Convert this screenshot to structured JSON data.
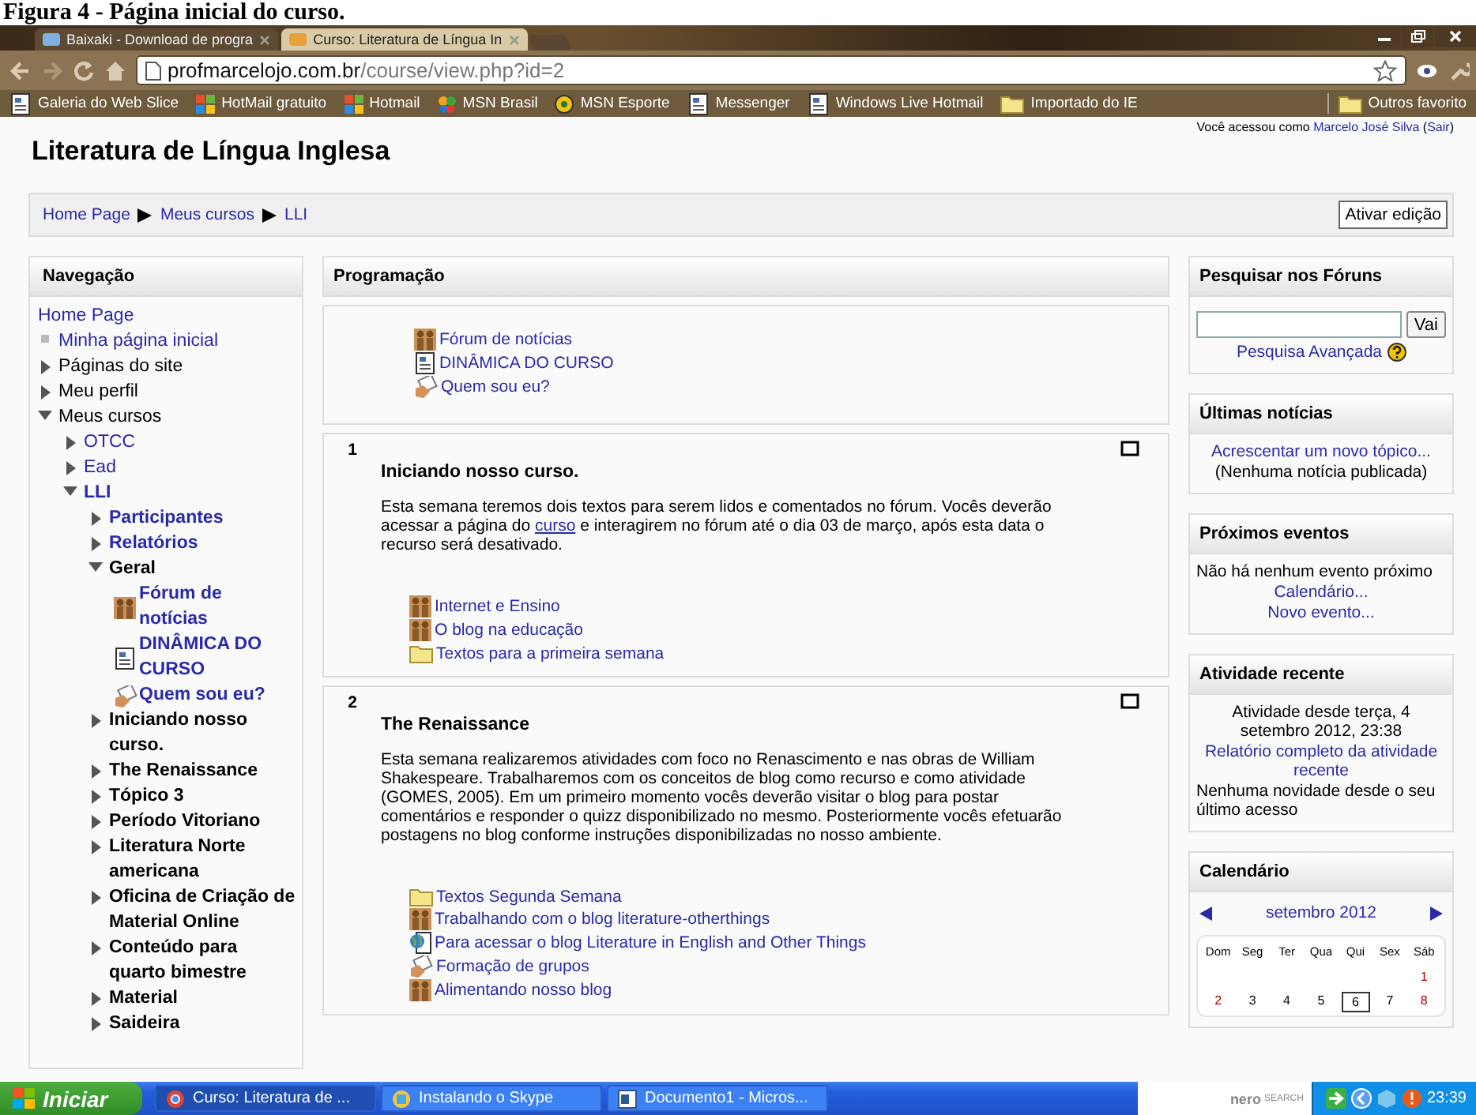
{
  "caption": "Figura 4 - Página inicial do curso.",
  "browser": {
    "tabs": [
      {
        "label": "Baixaki - Download de progra",
        "selected": false
      },
      {
        "label": "Curso: Literatura de Língua In",
        "selected": true
      }
    ],
    "url_host": "profmarcelojo.com.br",
    "url_path": "/course/view.php?id=2",
    "bookmarks": [
      "Galeria do Web Slice",
      "HotMail gratuito",
      "Hotmail",
      "MSN Brasil",
      "MSN Esporte",
      "Messenger",
      "Windows Live Hotmail",
      "Importado do IE"
    ],
    "other_bookmarks": "Outros favorito"
  },
  "header": {
    "title": "Literatura de Língua Inglesa",
    "login": [
      {
        "text": "Você acessou como "
      },
      {
        "text": "Marcelo José Silva",
        "link": true
      },
      {
        "text": " ("
      },
      {
        "text": "Sair",
        "link": true
      },
      {
        "text": ")"
      }
    ],
    "breadcrumb": [
      "Home Page",
      "Meus cursos",
      "LLI"
    ],
    "edit_button": "Ativar edição"
  },
  "nav": {
    "title": "Navegação",
    "items": [
      {
        "label": "Home Page",
        "kind": "root",
        "link": true
      },
      {
        "label": "Minha página inicial",
        "kind": "leaf",
        "link": true
      },
      {
        "label": "Páginas do site",
        "kind": "branch",
        "link": false,
        "expanded": false
      },
      {
        "label": "Meu perfil",
        "kind": "branch",
        "link": false,
        "expanded": false
      },
      {
        "label": "Meus cursos",
        "kind": "branch",
        "link": false,
        "expanded": true,
        "children": [
          {
            "label": "OTCC",
            "kind": "branch",
            "link": true,
            "expanded": false
          },
          {
            "label": "Ead",
            "kind": "branch",
            "link": true,
            "expanded": false
          },
          {
            "label": "LLI",
            "kind": "branch",
            "link": true,
            "expanded": true,
            "current": true,
            "children": [
              {
                "label": "Participantes",
                "kind": "branch",
                "link": true,
                "expanded": false
              },
              {
                "label": "Relatórios",
                "kind": "branch",
                "link": true,
                "expanded": false
              },
              {
                "label": "Geral",
                "kind": "branch",
                "link": false,
                "expanded": true,
                "children": [
                  {
                    "label": "Fórum de notícias",
                    "kind": "forum",
                    "link": true
                  },
                  {
                    "label": "DINÂMICA DO CURSO",
                    "kind": "page",
                    "link": true
                  },
                  {
                    "label": "Quem sou eu?",
                    "kind": "choice",
                    "link": true
                  }
                ]
              },
              {
                "label": "Iniciando nosso curso.",
                "kind": "branch",
                "link": false,
                "expanded": false
              },
              {
                "label": "The Renaissance",
                "kind": "branch",
                "link": false,
                "expanded": false
              },
              {
                "label": "Tópico 3",
                "kind": "branch",
                "link": false,
                "expanded": false
              },
              {
                "label": "Período Vitoriano",
                "kind": "branch",
                "link": false,
                "expanded": false
              },
              {
                "label": "Literatura Norte americana",
                "kind": "branch",
                "link": false,
                "expanded": false
              },
              {
                "label": "Oficina de Criação de Material Online",
                "kind": "branch",
                "link": false,
                "expanded": false
              },
              {
                "label": "Conteúdo para quarto bimestre",
                "kind": "branch",
                "link": false,
                "expanded": false
              },
              {
                "label": "Material",
                "kind": "branch",
                "link": false,
                "expanded": false
              },
              {
                "label": "Saideira",
                "kind": "branch",
                "link": false,
                "expanded": false
              }
            ]
          }
        ]
      }
    ]
  },
  "main": {
    "title": "Programação",
    "sections": [
      {
        "activities": [
          {
            "label": "Fórum de notícias",
            "kind": "forum"
          },
          {
            "label": "DINÂMICA DO CURSO",
            "kind": "page"
          },
          {
            "label": "Quem sou eu?",
            "kind": "choice"
          }
        ]
      },
      {
        "number": "1",
        "title": "Iniciando nosso curso.",
        "summary": [
          {
            "text": "Esta semana teremos dois textos para serem lidos e comentados no fórum. Vocês deverão acessar a página do "
          },
          {
            "text": "curso",
            "link": true
          },
          {
            "text": " e interagirem no fórum até o dia 03 de março, após esta data o recurso será desativado."
          }
        ],
        "activities": [
          {
            "label": "Internet e Ensino",
            "kind": "forum"
          },
          {
            "label": "O blog na educação",
            "kind": "forum"
          },
          {
            "label": "Textos para a primeira semana",
            "kind": "folder"
          }
        ]
      },
      {
        "number": "2",
        "title": "The Renaissance",
        "summary": [
          {
            "text": "Esta semana realizaremos atividades com foco no Renascimento e nas obras de William Shakespeare. Trabalharemos com os conceitos de blog como recurso e como atividade (GOMES, 2005). Em um primeiro momento vocês deverão visitar o blog para postar comentários e responder o quizz disponibilizado no mesmo. Posteriormente vocês efetuarão postagens no blog conforme instruções disponibilizadas no nosso ambiente."
          }
        ],
        "activities": [
          {
            "label": "Textos Segunda Semana",
            "kind": "folder"
          },
          {
            "label": "Trabalhando com o blog literature-otherthings",
            "kind": "forum"
          },
          {
            "label": "Para acessar o blog Literature in English and Other Things",
            "kind": "url"
          },
          {
            "label": "Formação de grupos",
            "kind": "choice"
          },
          {
            "label": "Alimentando nosso blog",
            "kind": "forum"
          }
        ]
      }
    ]
  },
  "blocks": [
    {
      "title": "Pesquisar nos Fóruns",
      "items": [
        {
          "kind": "search",
          "button": "Vai"
        },
        {
          "kind": "help-link",
          "text": "Pesquisa Avançada"
        }
      ]
    },
    {
      "title": "Últimas notícias",
      "items": [
        {
          "kind": "link",
          "text": "Acrescentar um novo tópico..."
        },
        {
          "kind": "note",
          "text": "(Nenhuma notícia publicada)"
        }
      ]
    },
    {
      "title": "Próximos eventos",
      "items": [
        {
          "kind": "text",
          "text": "Não há nenhum evento próximo"
        },
        {
          "kind": "link",
          "text": "Calendário..."
        },
        {
          "kind": "link",
          "text": "Novo evento..."
        }
      ]
    },
    {
      "title": "Atividade recente",
      "items": [
        {
          "kind": "note",
          "text": "Atividade desde terça, 4 setembro 2012, 23:38"
        },
        {
          "kind": "link",
          "text": "Relatório completo da atividade recente"
        },
        {
          "kind": "text",
          "text": "Nenhuma novidade desde o seu último acesso"
        }
      ]
    },
    {
      "title": "Calendário",
      "items": [
        {
          "kind": "calendar",
          "month": "setembro 2012",
          "weekdays": [
            "Dom",
            "Seg",
            "Ter",
            "Qua",
            "Qui",
            "Sex",
            "Sáb"
          ],
          "weeks": [
            [
              {
                "day": "1",
                "today": false
              }
            ],
            [
              {
                "day": "2",
                "today": false
              },
              {
                "day": "3",
                "today": false
              },
              {
                "day": "4",
                "today": false
              },
              {
                "day": "5",
                "today": false
              },
              {
                "day": "6",
                "today": true
              },
              {
                "day": "7",
                "today": false
              },
              {
                "day": "8",
                "today": false
              }
            ]
          ]
        }
      ]
    }
  ],
  "taskbar": {
    "start": "Iniciar",
    "tasks": [
      {
        "label": "Curso: Literatura de ...",
        "selected": true
      },
      {
        "label": "Instalando o Skype",
        "selected": false
      },
      {
        "label": "Documento1 - Micros...",
        "selected": false
      }
    ],
    "search_logo": "nero",
    "search_label": "SEARCH",
    "time": "23:39"
  }
}
